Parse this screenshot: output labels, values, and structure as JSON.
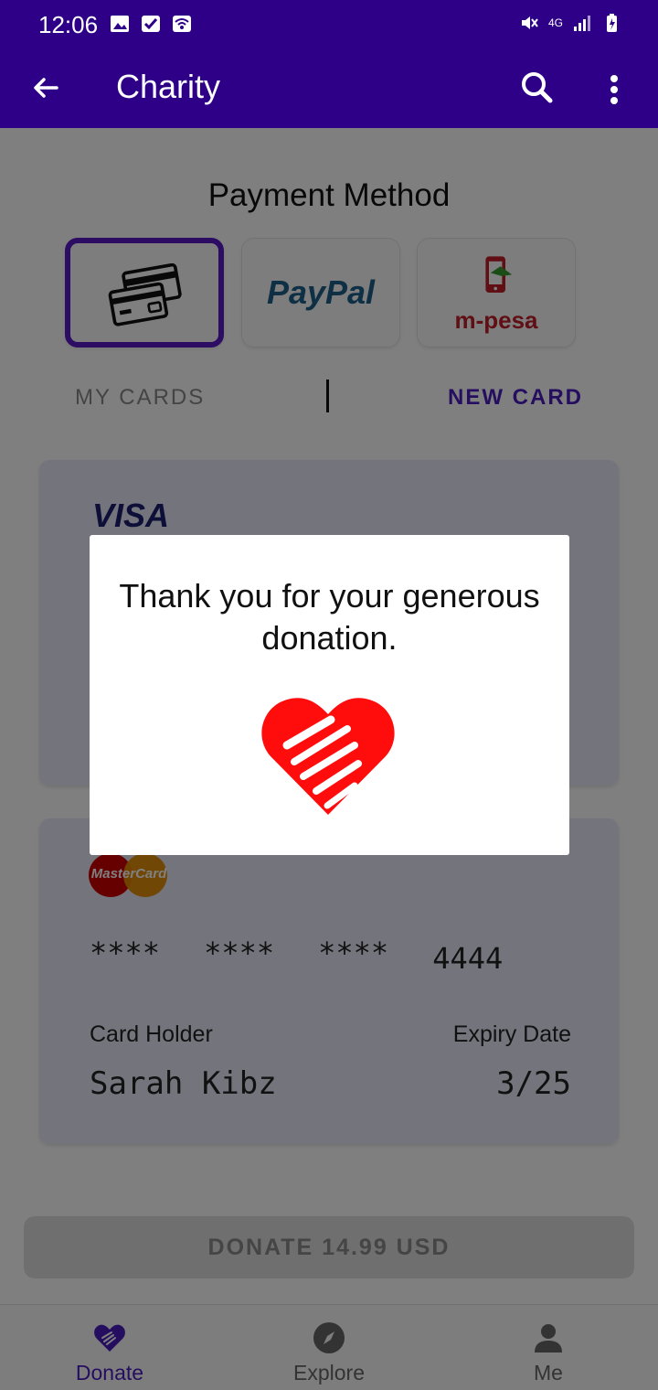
{
  "status_bar": {
    "time": "12:06",
    "network": "4G"
  },
  "app_bar": {
    "title": "Charity"
  },
  "payment": {
    "heading": "Payment Method",
    "options": [
      {
        "name": "cards",
        "selected": true
      },
      {
        "name": "PayPal",
        "selected": false
      },
      {
        "name": "m-pesa",
        "selected": false
      }
    ],
    "paypal_label": "PayPal",
    "mpesa_label": "m-pesa",
    "tabs": {
      "my_cards": "MY CARDS",
      "new_card": "NEW CARD",
      "active": "NEW CARD"
    }
  },
  "cards": {
    "visa": {
      "brand": "VISA"
    },
    "mastercard": {
      "brand": "MasterCard",
      "number_groups": [
        "****",
        "****",
        "****",
        "4444"
      ],
      "holder_label": "Card Holder",
      "holder_name": "Sarah Kibz",
      "expiry_label": "Expiry Date",
      "expiry_value": "3/25"
    }
  },
  "donate_button": {
    "label": "DONATE 14.99 USD"
  },
  "bottom_nav": {
    "items": [
      {
        "label": "Donate",
        "active": true,
        "icon": "heart-hand-icon"
      },
      {
        "label": "Explore",
        "active": false,
        "icon": "compass-icon"
      },
      {
        "label": "Me",
        "active": false,
        "icon": "person-icon"
      }
    ]
  },
  "dialog": {
    "message": "Thank you for your generous donation.",
    "icon": "heart-handshake-icon"
  },
  "colors": {
    "primary": "#2e0087",
    "accent": "#4b1dc0",
    "heart": "#ff0000"
  }
}
